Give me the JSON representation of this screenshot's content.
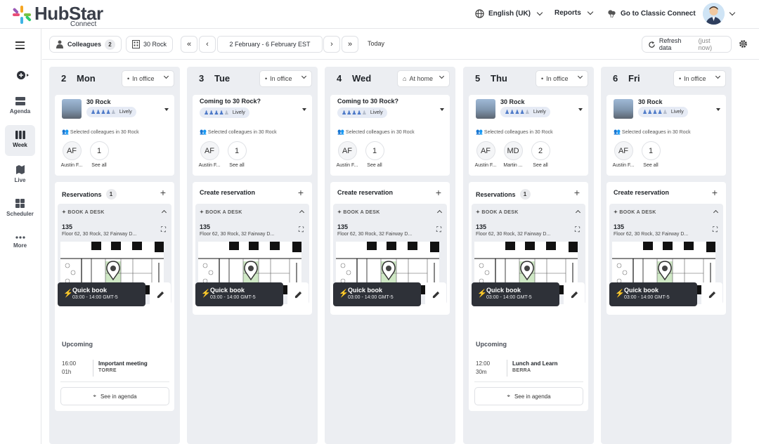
{
  "app": {
    "title": "HubStar",
    "subtitle": "Connect"
  },
  "topnav": {
    "language": "English (UK)",
    "reports": "Reports",
    "classic": "Go to Classic Connect"
  },
  "sidebar": {
    "items": [
      {
        "label": "Agenda"
      },
      {
        "label": "Week"
      },
      {
        "label": "Live"
      },
      {
        "label": "Scheduler"
      },
      {
        "label": "More"
      }
    ]
  },
  "toolbar": {
    "colleagues_label": "Colleagues",
    "colleagues_count": "2",
    "building": "30 Rock",
    "date_range": "2 February - 6 February EST",
    "today": "Today",
    "refresh": "Refresh data",
    "refresh_note": "(just now)"
  },
  "days": [
    {
      "num": "2",
      "name": "Mon",
      "status": "In office",
      "loc_title": "30 Rock",
      "has_image": true,
      "lively": "Lively",
      "lively_level": 4,
      "selected": "Selected colleagues in 30 Rock",
      "people": [
        {
          "initials": "AF",
          "name": "Austin F..."
        }
      ],
      "see_all_count": "1",
      "see_all": "See all",
      "res_title": "Reservations",
      "res_count": "1",
      "book_head": "BOOK A DESK",
      "desk": "135",
      "desk_loc": "Floor 62, 30 Rock, 32 Fairway D...",
      "qb_title": "Quick book",
      "qb_time": "03:00 - 14:00 GMT-5",
      "upcoming": "Upcoming",
      "event": {
        "time": "16:00",
        "dur": "01h",
        "name": "Important meeting",
        "room": "TORRE"
      },
      "agenda_btn": "See in agenda"
    },
    {
      "num": "3",
      "name": "Tue",
      "status": "In office",
      "loc_title": "Coming to 30 Rock?",
      "has_image": false,
      "lively": "Lively",
      "lively_level": 4,
      "selected": "Selected colleagues in 30 Rock",
      "people": [
        {
          "initials": "AF",
          "name": "Austin F..."
        }
      ],
      "see_all_count": "1",
      "see_all": "See all",
      "res_title": "Create reservation",
      "res_count": "",
      "book_head": "BOOK A DESK",
      "desk": "135",
      "desk_loc": "Floor 62, 30 Rock, 32 Fairway D...",
      "qb_title": "Quick book",
      "qb_time": "03:00 - 14:00 GMT-5"
    },
    {
      "num": "4",
      "name": "Wed",
      "status": "At home",
      "loc_title": "Coming to 30 Rock?",
      "has_image": false,
      "lively": "Lively",
      "lively_level": 4,
      "selected": "Selected colleagues in 30 Rock",
      "people": [
        {
          "initials": "AF",
          "name": "Austin F..."
        }
      ],
      "see_all_count": "1",
      "see_all": "See all",
      "res_title": "Create reservation",
      "res_count": "",
      "book_head": "BOOK A DESK",
      "desk": "135",
      "desk_loc": "Floor 62, 30 Rock, 32 Fairway D...",
      "qb_title": "Quick book",
      "qb_time": "03:00 - 14:00 GMT-5"
    },
    {
      "num": "5",
      "name": "Thu",
      "status": "In office",
      "loc_title": "30 Rock",
      "has_image": true,
      "lively": "Lively",
      "lively_level": 4,
      "selected": "Selected colleagues in 30 Rock",
      "people": [
        {
          "initials": "AF",
          "name": "Austin F..."
        },
        {
          "initials": "MD",
          "name": "Martin ..."
        }
      ],
      "see_all_count": "2",
      "see_all": "See all",
      "res_title": "Reservations",
      "res_count": "1",
      "book_head": "BOOK A DESK",
      "desk": "135",
      "desk_loc": "Floor 62, 30 Rock, 32 Fairway D...",
      "qb_title": "Quick book",
      "qb_time": "03:00 - 14:00 GMT-5",
      "upcoming": "Upcoming",
      "event": {
        "time": "12:00",
        "dur": "30m",
        "name": "Lunch and Learn",
        "room": "BERRA"
      },
      "agenda_btn": "See in agenda"
    },
    {
      "num": "6",
      "name": "Fri",
      "status": "In office",
      "loc_title": "30 Rock",
      "has_image": true,
      "lively": "Lively",
      "lively_level": 4,
      "selected": "Selected colleagues in 30 Rock",
      "people": [
        {
          "initials": "AF",
          "name": "Austin F..."
        }
      ],
      "see_all_count": "1",
      "see_all": "See all",
      "res_title": "Create reservation",
      "res_count": "",
      "book_head": "BOOK A DESK",
      "desk": "135",
      "desk_loc": "Floor 62, 30 Rock, 32 Fairway D...",
      "qb_title": "Quick book",
      "qb_time": "03:00 - 14:00 GMT-5"
    }
  ],
  "colors": {
    "accent_blue": "#4b78c7",
    "dark_button": "#2e3138",
    "column_bg": "#eceef2",
    "desk_highlight": "#cfe8c5"
  }
}
